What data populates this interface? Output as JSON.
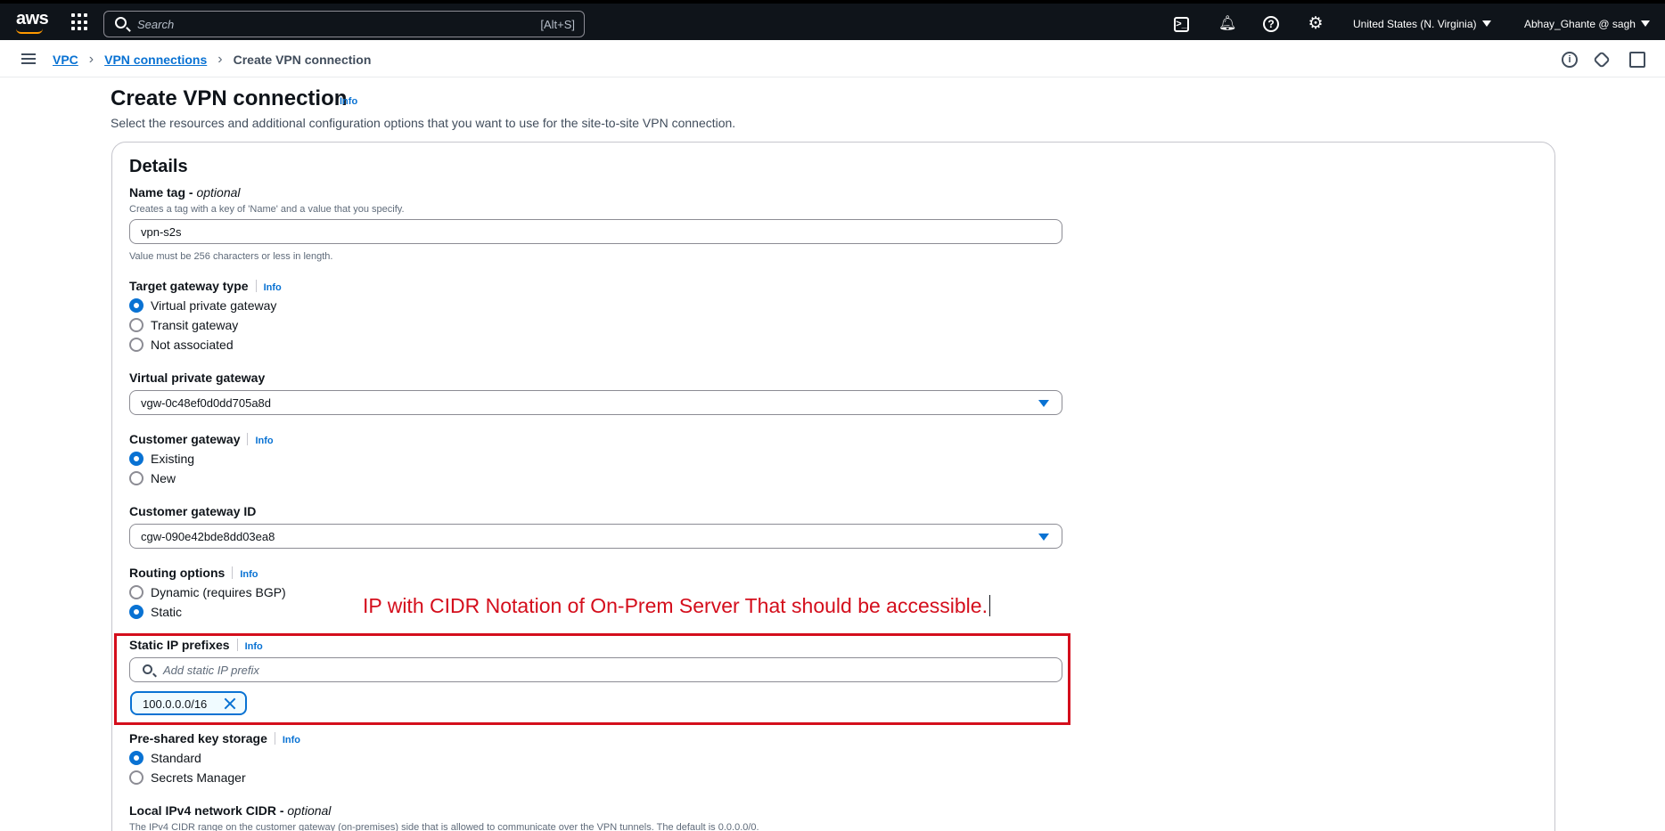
{
  "topnav": {
    "logo": "aws",
    "search_placeholder": "Search",
    "search_shortcut": "[Alt+S]",
    "region": "United States (N. Virginia)",
    "user": "Abhay_Ghante @ sagh"
  },
  "breadcrumb": {
    "items": [
      "VPC",
      "VPN connections"
    ],
    "current": "Create VPN connection"
  },
  "page": {
    "title": "Create VPN connection",
    "info": "Info",
    "description": "Select the resources and additional configuration options that you want to use for the site-to-site VPN connection."
  },
  "details": {
    "title": "Details",
    "name_tag": {
      "label": "Name tag - ",
      "optional": "optional",
      "hint": "Creates a tag with a key of 'Name' and a value that you specify.",
      "value": "vpn-s2s",
      "constraint": "Value must be 256 characters or less in length."
    },
    "target_gateway_type": {
      "label": "Target gateway type",
      "info": "Info",
      "options": [
        "Virtual private gateway",
        "Transit gateway",
        "Not associated"
      ],
      "selected": "Virtual private gateway"
    },
    "virtual_private_gateway": {
      "label": "Virtual private gateway",
      "value": "vgw-0c48ef0d0dd705a8d"
    },
    "customer_gateway": {
      "label": "Customer gateway",
      "info": "Info",
      "options": [
        "Existing",
        "New"
      ],
      "selected": "Existing"
    },
    "customer_gateway_id": {
      "label": "Customer gateway ID",
      "value": "cgw-090e42bde8dd03ea8"
    },
    "routing_options": {
      "label": "Routing options",
      "info": "Info",
      "options": [
        "Dynamic (requires BGP)",
        "Static"
      ],
      "selected": "Static"
    },
    "static_ip_prefixes": {
      "label": "Static IP prefixes",
      "info": "Info",
      "placeholder": "Add static IP prefix",
      "tokens": [
        "100.0.0.0/16"
      ]
    },
    "psk_storage": {
      "label": "Pre-shared key storage",
      "info": "Info",
      "options": [
        "Standard",
        "Secrets Manager"
      ],
      "selected": "Standard"
    },
    "local_ipv4_cidr": {
      "label": "Local IPv4 network CIDR - ",
      "optional": "optional",
      "hint": "The IPv4 CIDR range on the customer gateway (on-premises) side that is allowed to communicate over the VPN tunnels. The default is 0.0.0.0/0."
    }
  },
  "annotation": {
    "text": "IP with CIDR Notation of On-Prem Server That should be accessible.",
    "color": "#d40e1c"
  },
  "colors": {
    "accent": "#0972d3",
    "nav_bg": "#0f141a",
    "brand_orange": "#ff9900"
  }
}
